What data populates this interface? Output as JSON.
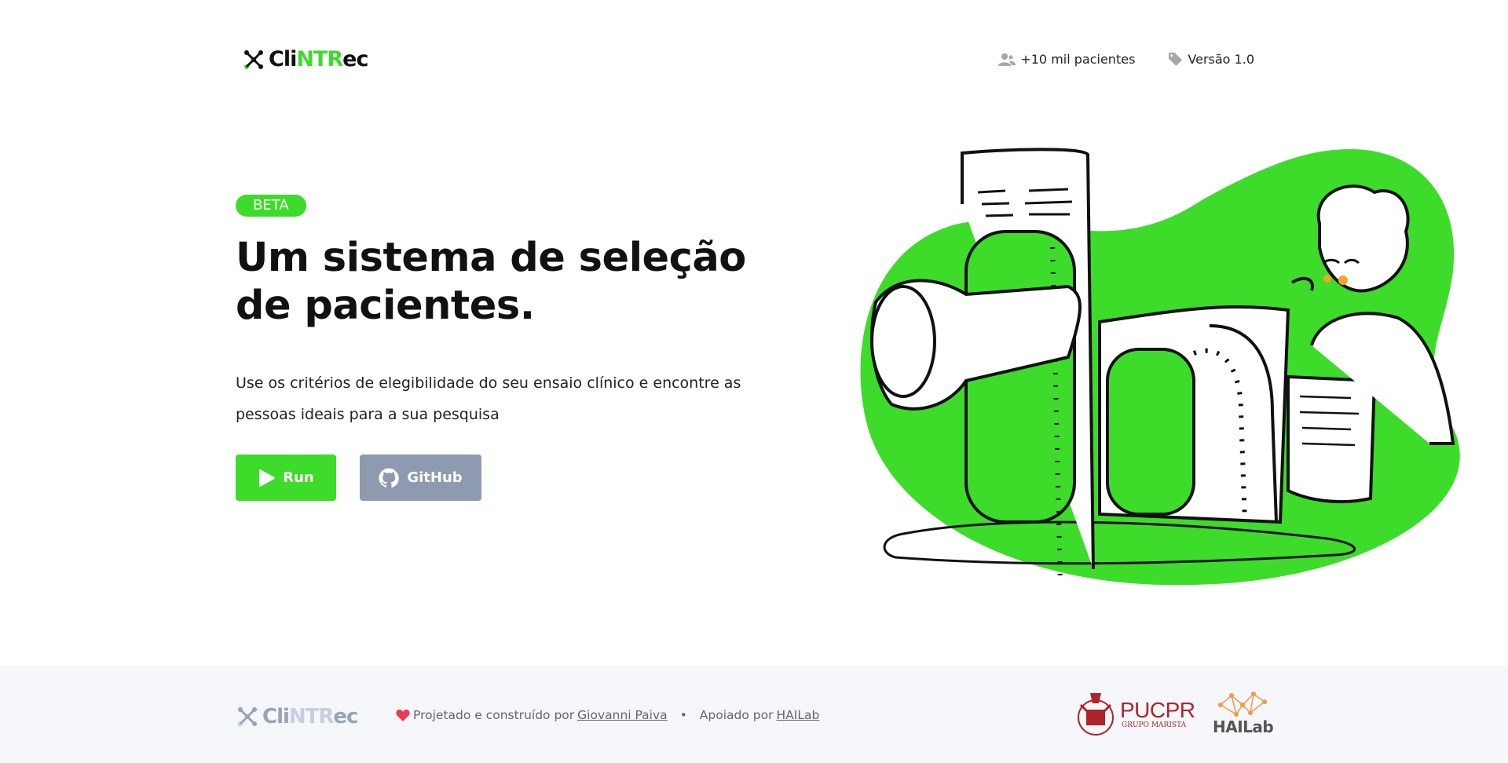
{
  "header": {
    "logo": {
      "part1": "Cli",
      "part2": "NTR",
      "part3": "ec"
    },
    "nav": [
      {
        "icon": "users-icon",
        "label": "+10 mil pacientes"
      },
      {
        "icon": "tag-icon",
        "label": "Versão 1.0"
      }
    ]
  },
  "hero": {
    "badge": "BETA",
    "headline": "Um sistema de seleção de pacientes.",
    "description": "Use os critérios de elegibilidade do seu ensaio clínico e encontre as pessoas ideais para a sua pesquisa",
    "buttons": {
      "run": {
        "label": "Run",
        "icon": "play-icon"
      },
      "github": {
        "label": "GitHub",
        "icon": "github-icon"
      }
    }
  },
  "footer": {
    "logo": {
      "part1": "Cli",
      "part2": "NTR",
      "part3": "ec"
    },
    "credit_prefix": "Projetado e construído por",
    "author": "Giovanni Paiva",
    "separator": "•",
    "support_prefix": "Apoiado por",
    "support_link": "HAILab",
    "partners": {
      "pucpr": {
        "name": "PUCPR",
        "sub": "GRUPO MARISTA"
      },
      "hailab": {
        "name": "HAILab"
      }
    }
  },
  "colors": {
    "accent": "#3ddc2a",
    "github_button": "#8e9ab0",
    "footer_bg": "#f5f7fa",
    "pucpr_red": "#b0232a",
    "hailab_orange": "#f29a4a"
  }
}
